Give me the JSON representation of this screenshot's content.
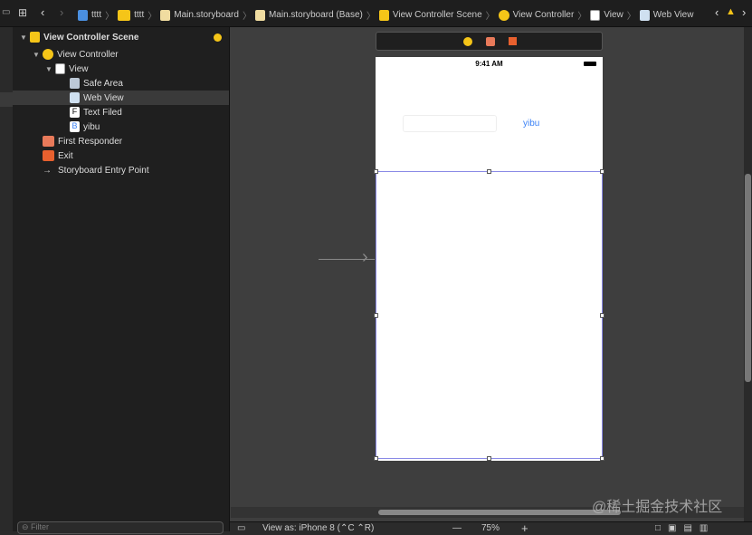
{
  "breadcrumb": [
    "tttt",
    "tttt",
    "Main.storyboard",
    "Main.storyboard (Base)",
    "View Controller Scene",
    "View Controller",
    "View",
    "Web View"
  ],
  "outline": [
    {
      "label": "View Controller Scene",
      "icon": "scene-icon",
      "level": 0,
      "bold": true
    },
    {
      "label": "View Controller",
      "icon": "view-controller-icon",
      "level": 1
    },
    {
      "label": "View",
      "icon": "view-icon",
      "level": 2
    },
    {
      "label": "Safe Area",
      "icon": "safe-area-icon",
      "level": 3
    },
    {
      "label": "Web View",
      "icon": "web-view-icon",
      "level": 3,
      "selected": true
    },
    {
      "label": "Text Filed",
      "icon": "text-field-icon",
      "level": 3
    },
    {
      "label": "yibu",
      "icon": "button-icon",
      "level": 3
    },
    {
      "label": "First Responder",
      "icon": "first-responder-icon",
      "level": 1
    },
    {
      "label": "Exit",
      "icon": "exit-icon",
      "level": 1
    },
    {
      "label": "Storyboard Entry Point",
      "icon": "arrow-right-icon",
      "level": 1
    }
  ],
  "phone": {
    "time": "9:41 AM",
    "button_label": "yibu",
    "button_color": "#3b82f6"
  },
  "filter_placeholder": "Filter",
  "bottom": {
    "view_as": "View as: iPhone 8 (⌃C ⌃R)",
    "zoom": "75%",
    "minus": "—",
    "plus": "+"
  },
  "watermark": "@稀土掘金技术社区",
  "colors": {
    "accent": "#f5c518",
    "selection": "#6e6ee0"
  }
}
